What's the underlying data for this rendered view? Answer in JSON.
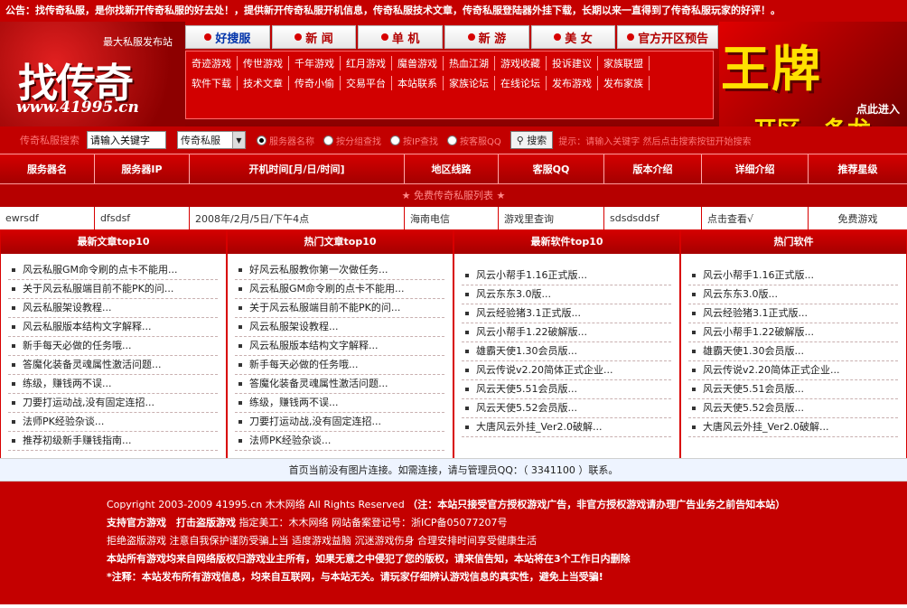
{
  "notice": "公告：找传奇私服，是你找新开传奇私服的好去处！，提供新开传奇私服开机信息，传奇私服技术文章，传奇私服登陆器外挂下载，长期以来一直得到了传奇私服玩家的好评！。",
  "logo": {
    "tagline": "最大私服发布站",
    "main": "找传奇",
    "url": "www.41995.cn"
  },
  "nav": {
    "tabs": [
      "好搜服",
      "新 闻",
      "单 机",
      "新 游",
      "美 女",
      "官方开区预告"
    ],
    "links_row1": [
      "奇迹游戏",
      "传世游戏",
      "千年游戏",
      "红月游戏",
      "魔兽游戏",
      "热血江湖",
      "游戏收藏",
      "投诉建议",
      "家族联盟"
    ],
    "links_row2": [
      "软件下载",
      "技术文章",
      "传奇小偷",
      "交易平台",
      "本站联系",
      "家族论坛",
      "在线论坛",
      "发布游戏",
      "发布家族"
    ]
  },
  "banner": {
    "big": "王牌",
    "click": "点此进入",
    "sub": "开区一条龙"
  },
  "search": {
    "label": "传奇私服搜索",
    "keyword_placeholder": "请输入关键字",
    "select_value": "传奇私服",
    "options": [
      "服务器名称",
      "按分组查找",
      "按IP查找",
      "按客服QQ"
    ],
    "button": "搜索",
    "tip": "提示：请输入关键字 然后点击搜索按钮开始搜索"
  },
  "table": {
    "headers": [
      "服务器名",
      "服务器IP",
      "开机时间[月/日/时间]",
      "地区线路",
      "客服QQ",
      "版本介绍",
      "详细介绍",
      "推荐星级"
    ],
    "section": "★ 免费传奇私服列表 ★",
    "row": [
      "ewrsdf",
      "dfsdsf",
      "2008年/2月/5日/下午4点",
      "海南电信",
      "游戏里查询",
      "sdsdsddsf",
      "点击查看√",
      "免费游戏"
    ]
  },
  "columns": [
    {
      "title": "最新文章top10",
      "items": [
        "风云私服GM命令刷的点卡不能用...",
        "关于风云私服端目前不能PK的问...",
        "风云私服架设教程...",
        "风云私服版本结构文字解释...",
        "新手每天必做的任务哦...",
        "答魔化装备灵魂属性激活问题...",
        "练级，赚钱两不误...",
        "刀要打运动战,没有固定连招...",
        "法师PK经验杂谈...",
        "推荐初级新手赚钱指南..."
      ]
    },
    {
      "title": "热门文章top10",
      "items": [
        "好风云私服教你第一次做任务...",
        "风云私服GM命令刷的点卡不能用...",
        "关于风云私服端目前不能PK的问...",
        "风云私服架设教程...",
        "风云私服版本结构文字解释...",
        "新手每天必做的任务哦...",
        "答魔化装备灵魂属性激活问题...",
        "练级，赚钱两不误...",
        "刀要打运动战,没有固定连招...",
        "法师PK经验杂谈..."
      ]
    },
    {
      "title": "最新软件top10",
      "items": [
        "风云小帮手1.16正式版...",
        "风云东东3.0版...",
        "风云经验猪3.1正式版...",
        "风云小帮手1.22破解版...",
        "雄霸天使1.30会员版...",
        "风云传说v2.20简体正式企业...",
        "风云天使5.51会员版...",
        "风云天使5.52会员版...",
        "大唐风云外挂_Ver2.0破解..."
      ]
    },
    {
      "title": "热门软件",
      "items": [
        "风云小帮手1.16正式版...",
        "风云东东3.0版...",
        "风云经验猪3.1正式版...",
        "风云小帮手1.22破解版...",
        "雄霸天使1.30会员版...",
        "风云传说v2.20简体正式企业...",
        "风云天使5.51会员版...",
        "风云天使5.52会员版...",
        "大唐风云外挂_Ver2.0破解..."
      ]
    }
  ],
  "linkstrip": "首页当前没有图片连接。如需连接，请与管理员QQ：（ 3341100 ）联系。",
  "footer": {
    "line1_a": "Copyright 2003-2009 41995.cn 木木网络 All Rights Reserved",
    "line1_b": "（注：本站只接受官方授权游戏广告，非官方授权游戏请办理广告业务之前告知本站）",
    "line2_a": "支持官方游戏　打击盗版游戏",
    "line2_b": "指定美工：木木网络 网站备案登记号：浙ICP备05077207号",
    "line3": "拒绝盗版游戏 注意自我保护谨防受骗上当 适度游戏益脑 沉迷游戏伤身 合理安排时间享受健康生活",
    "line4": "本站所有游戏均来自网络版权归游戏业主所有，如果无意之中侵犯了您的版权，请来信告知，本站将在3个工作日内删除",
    "line5": "*注释：本站发布所有游戏信息，均来自互联网，与本站无关。请玩家仔细辨认游戏信息的真实性，避免上当受骗!"
  }
}
